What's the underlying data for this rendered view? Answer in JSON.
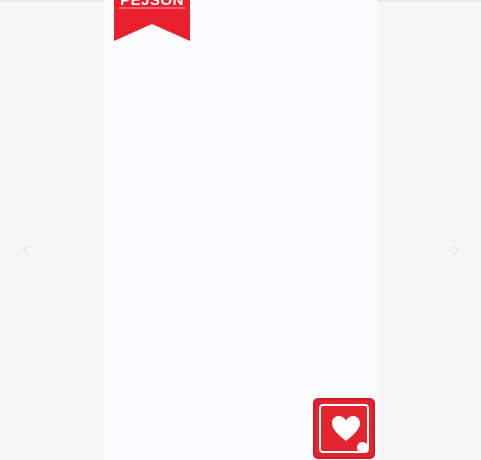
{
  "brand": {
    "ribbon_text": "PEJSON",
    "ribbon_color": "#e8202d"
  },
  "navigation": {
    "prev_icon": "chevron-left-icon",
    "next_icon": "chevron-right-icon",
    "prev_glyph": "‹",
    "next_glyph": "›"
  },
  "favorite": {
    "icon": "heart-icon",
    "color": "#e3242f"
  }
}
